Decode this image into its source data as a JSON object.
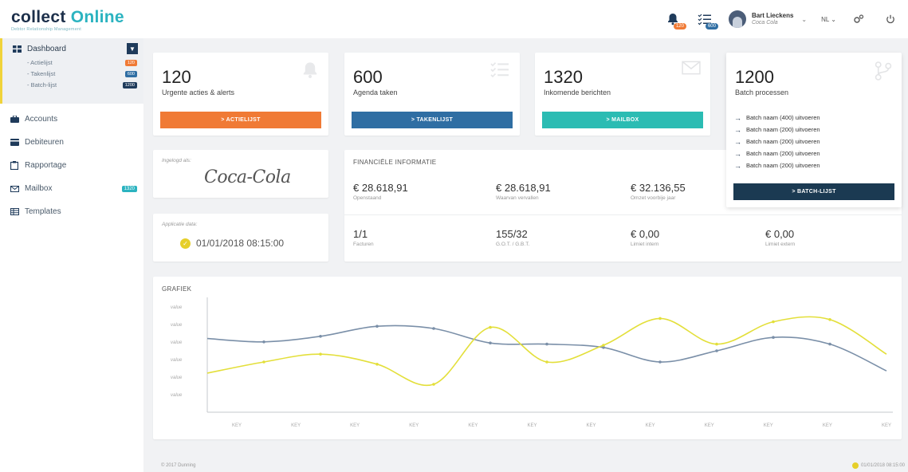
{
  "app": {
    "logo_text_a": "collect ",
    "logo_text_b": "Online",
    "logo_sub": "Debtor Relationship Management"
  },
  "header": {
    "alerts_badge": "120",
    "tasks_badge": "600",
    "user_name": "Bart Lieckens",
    "user_company": "Coca Cola",
    "language": "NL"
  },
  "sidebar": {
    "dashboard": "Dashboard",
    "sub_items": [
      {
        "label": "- Actielijst",
        "count": "120",
        "color": "#f07a35"
      },
      {
        "label": "- Takenlijst",
        "count": "600",
        "color": "#2f6ea3"
      },
      {
        "label": "- Batch-lijst",
        "count": "1200",
        "color": "#1f3b5b"
      }
    ],
    "items": [
      {
        "label": "Accounts"
      },
      {
        "label": "Debiteuren"
      },
      {
        "label": "Rapportage"
      },
      {
        "label": "Mailbox",
        "count": "1320"
      },
      {
        "label": "Templates"
      }
    ]
  },
  "stats": [
    {
      "number": "120",
      "label": "Urgente acties & alerts",
      "button": "> ACTIELIJST",
      "color": "#f07a35"
    },
    {
      "number": "600",
      "label": "Agenda taken",
      "button": "> TAKENLIJST",
      "color": "#2f6ea3"
    },
    {
      "number": "1320",
      "label": "Inkomende berichten",
      "button": "> MAILBOX",
      "color": "#2bbcb3"
    },
    {
      "number": "1200",
      "label": "Batch processen",
      "button": "> BATCH-LIJST",
      "color": "#1b3a52"
    }
  ],
  "batch_items": [
    "Batch naam (400) uitvoeren",
    "Batch naam (200) uitvoeren",
    "Batch naam (200) uitvoeren",
    "Batch naam (200) uitvoeren",
    "Batch naam (200) uitvoeren"
  ],
  "login": {
    "label": "Ingelogd als:",
    "brand": "Coca-Cola"
  },
  "appdate": {
    "label": "Applicatie data:",
    "value": "01/01/2018 08:15:00"
  },
  "finance": {
    "title": "FINANCIËLE INFORMATIE",
    "cells": [
      {
        "value": "€ 28.618,91",
        "label": "Openstaand"
      },
      {
        "value": "€ 28.618,91",
        "label": "Waarvan vervallen"
      },
      {
        "value": "€ 32.136,55",
        "label": "Omzet voorbije jaar"
      },
      {
        "value": "1/1",
        "label": "Facturen"
      },
      {
        "value": "155/32",
        "label": "G.O.T. / G.B.T."
      },
      {
        "value": "€ 0,00",
        "label": "Limiet intern"
      },
      {
        "value": "€ 0,00",
        "label": "Limiet extern"
      }
    ]
  },
  "chart": {
    "title": "GRAFIEK"
  },
  "chart_data": {
    "type": "line",
    "title": "GRAFIEK",
    "y_tick_labels": [
      "value",
      "value",
      "value",
      "value",
      "value",
      "value"
    ],
    "categories": [
      "KEY",
      "KEY",
      "KEY",
      "KEY",
      "KEY",
      "KEY",
      "KEY",
      "KEY",
      "KEY",
      "KEY",
      "KEY",
      "KEY"
    ],
    "grid": false,
    "series": [
      {
        "color": "#7a8fa8",
        "values": [
          3.3,
          3.15,
          3.4,
          3.85,
          3.75,
          3.1,
          3.05,
          2.9,
          2.25,
          2.75,
          3.35,
          3.05,
          1.85
        ]
      },
      {
        "color": "#e3df3a",
        "values": [
          1.75,
          2.25,
          2.6,
          2.15,
          1.25,
          3.8,
          2.25,
          3.0,
          4.2,
          3.05,
          4.05,
          4.15,
          2.6
        ]
      }
    ],
    "ylim": [
      0,
      5
    ]
  },
  "footer": {
    "copyright": "© 2017 Dunning",
    "datetime": "01/01/2018 08:15:00"
  },
  "colors": {
    "navy": "#1c2f4a",
    "teal": "#2bb3c0",
    "orange": "#f07a35",
    "yellow": "#e6cf2a"
  }
}
